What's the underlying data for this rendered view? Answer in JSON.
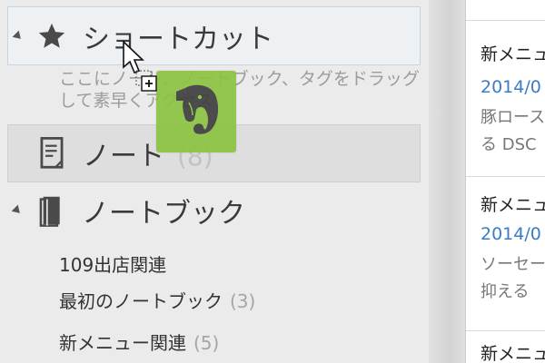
{
  "sidebar": {
    "shortcuts": {
      "label": "ショートカット",
      "hint": "ここにノート、ノートブック、タグをドラッグして素早くアクセス"
    },
    "notes": {
      "label": "ノート",
      "count": "(8)"
    },
    "notebooks": {
      "label": "ノートブック",
      "items": [
        {
          "label": "109出店関連",
          "count": ""
        },
        {
          "label": "最初のノートブック",
          "count": "(3)"
        },
        {
          "label": "新メニュー関連",
          "count": "(5)"
        }
      ]
    }
  },
  "note_list": {
    "cards": [
      {
        "title": "新メニュ",
        "date": "2014/0",
        "snippet1": "豚ロース",
        "snippet2": "る DSC"
      },
      {
        "title": "新メニュ",
        "date": "2014/0",
        "snippet1": "ソーセー",
        "snippet2": "抑える"
      },
      {
        "title": "新メニュ",
        "date": "",
        "snippet1": "",
        "snippet2": ""
      }
    ]
  },
  "colors": {
    "drag_ghost": "#8cc341",
    "date_link": "#3b7cc4",
    "shortcut_highlight": "#eef1f4"
  },
  "icons": {
    "shortcuts": "star-icon",
    "notes": "note-icon",
    "notebooks": "notebook-icon",
    "drag": "evernote-elephant-icon",
    "cursor": "drag-copy-cursor-icon"
  }
}
